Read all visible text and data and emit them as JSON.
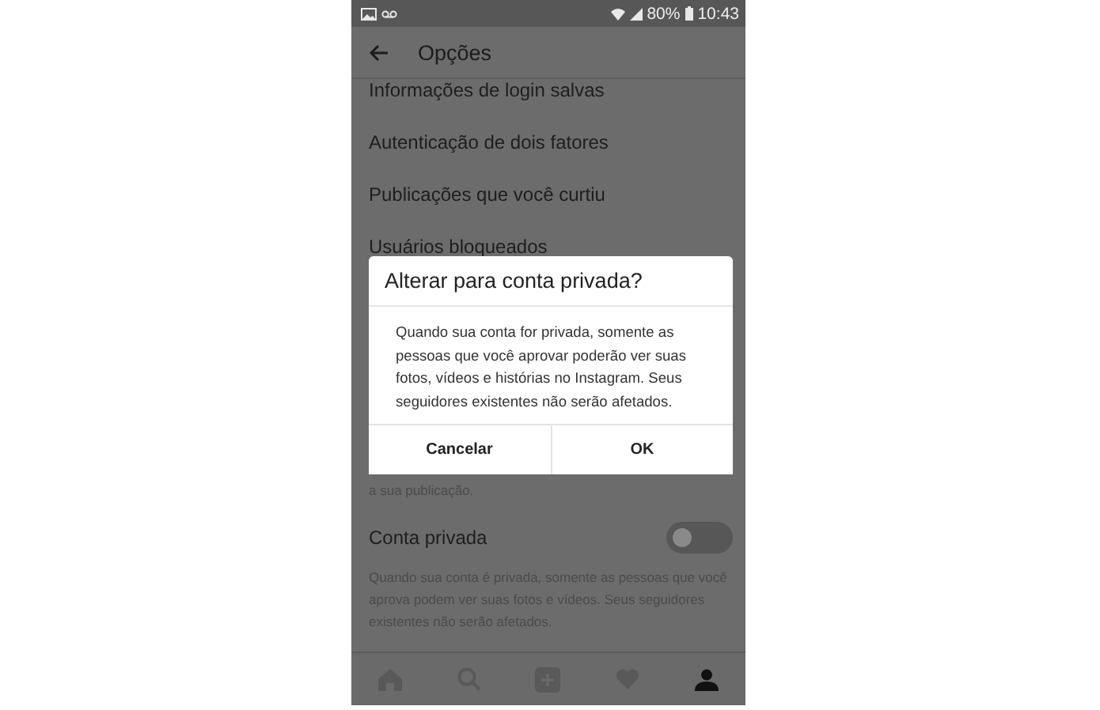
{
  "status_bar": {
    "battery": "80%",
    "time": "10:43"
  },
  "header": {
    "title": "Opções"
  },
  "options": [
    {
      "label": "Informações de login salvas"
    },
    {
      "label": "Autenticação de dois fatores"
    },
    {
      "label": "Publicações que você curtiu"
    },
    {
      "label": "Usuários bloqueados"
    }
  ],
  "hidden_note_tail": "a sua publicação.",
  "private_account": {
    "label": "Conta privada",
    "on": false,
    "description": "Quando sua conta é privada, somente as pessoas que você aprova podem ver suas fotos e vídeos. Seus seguidores existentes não serão afetados."
  },
  "dialog": {
    "title": "Alterar para conta privada?",
    "message": "Quando sua conta for privada, somente as pessoas que você aprovar poderão ver suas fotos, vídeos e histórias no Instagram. Seus seguidores existentes não serão afetados.",
    "buttons": [
      "Cancelar",
      "OK"
    ]
  },
  "bottom_nav": [
    {
      "kind": "home",
      "selected": false
    },
    {
      "kind": "search",
      "selected": false
    },
    {
      "kind": "add",
      "selected": false
    },
    {
      "kind": "activity",
      "selected": false
    },
    {
      "kind": "profile",
      "selected": true
    }
  ]
}
